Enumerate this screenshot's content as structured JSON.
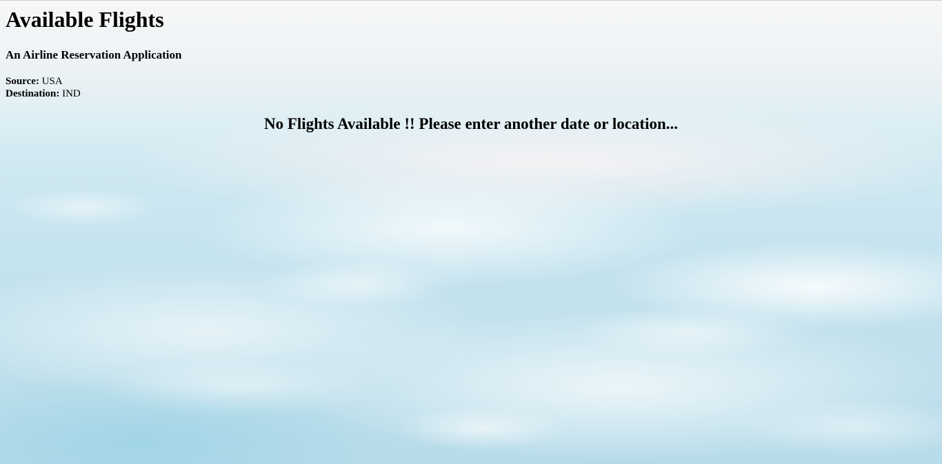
{
  "header": {
    "title": "Available Flights",
    "subtitle": "An Airline Reservation Application"
  },
  "route": {
    "source_label": "Source:",
    "source_value": "USA",
    "destination_label": "Destination:",
    "destination_value": "IND"
  },
  "main": {
    "message": "No Flights Available !! Please enter another date or location..."
  }
}
